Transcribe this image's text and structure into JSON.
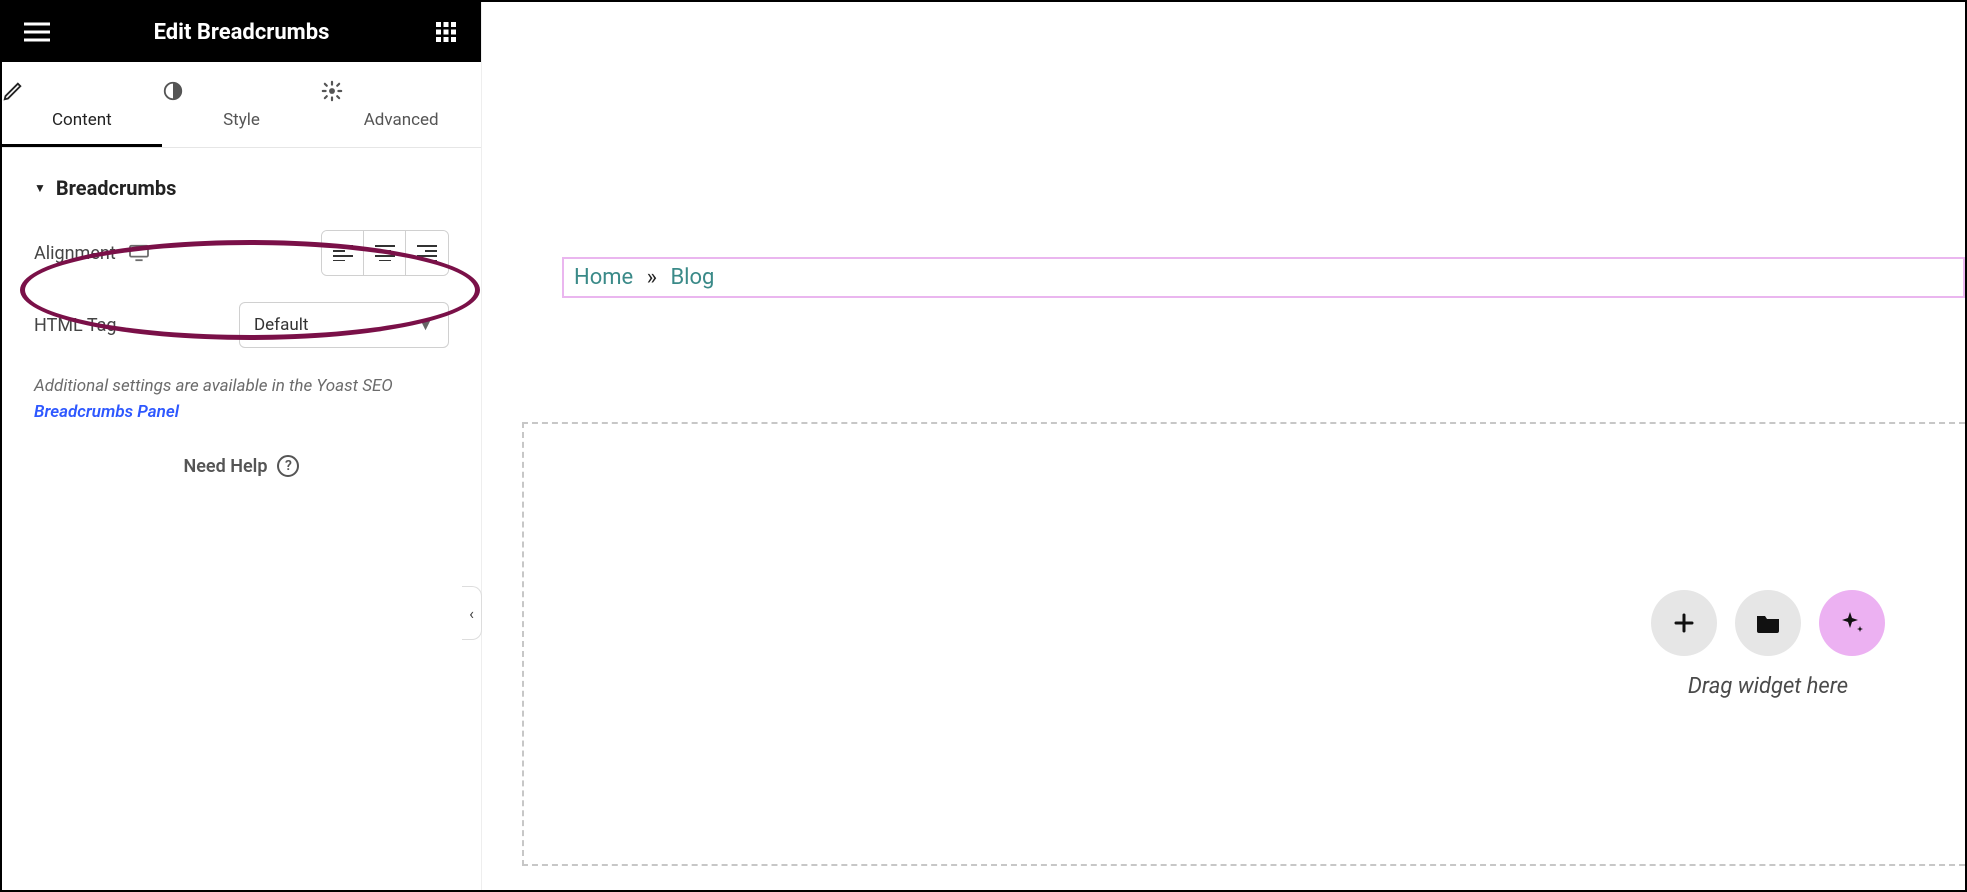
{
  "header": {
    "title": "Edit Breadcrumbs"
  },
  "tabs": {
    "content": "Content",
    "style": "Style",
    "advanced": "Advanced",
    "active": "content"
  },
  "section": {
    "title": "Breadcrumbs",
    "alignment_label": "Alignment",
    "htmltag_label": "HTML Tag",
    "htmltag_value": "Default",
    "note_prefix": "Additional settings are available in the Yoast SEO ",
    "note_link": "Breadcrumbs Panel"
  },
  "help": {
    "label": "Need Help"
  },
  "canvas": {
    "breadcrumb": {
      "items": [
        "Home",
        "Blog"
      ],
      "separator": "»"
    },
    "dropzone": {
      "hint": "Drag widget here"
    }
  },
  "annotation": {
    "highlight": "alignment-row"
  }
}
